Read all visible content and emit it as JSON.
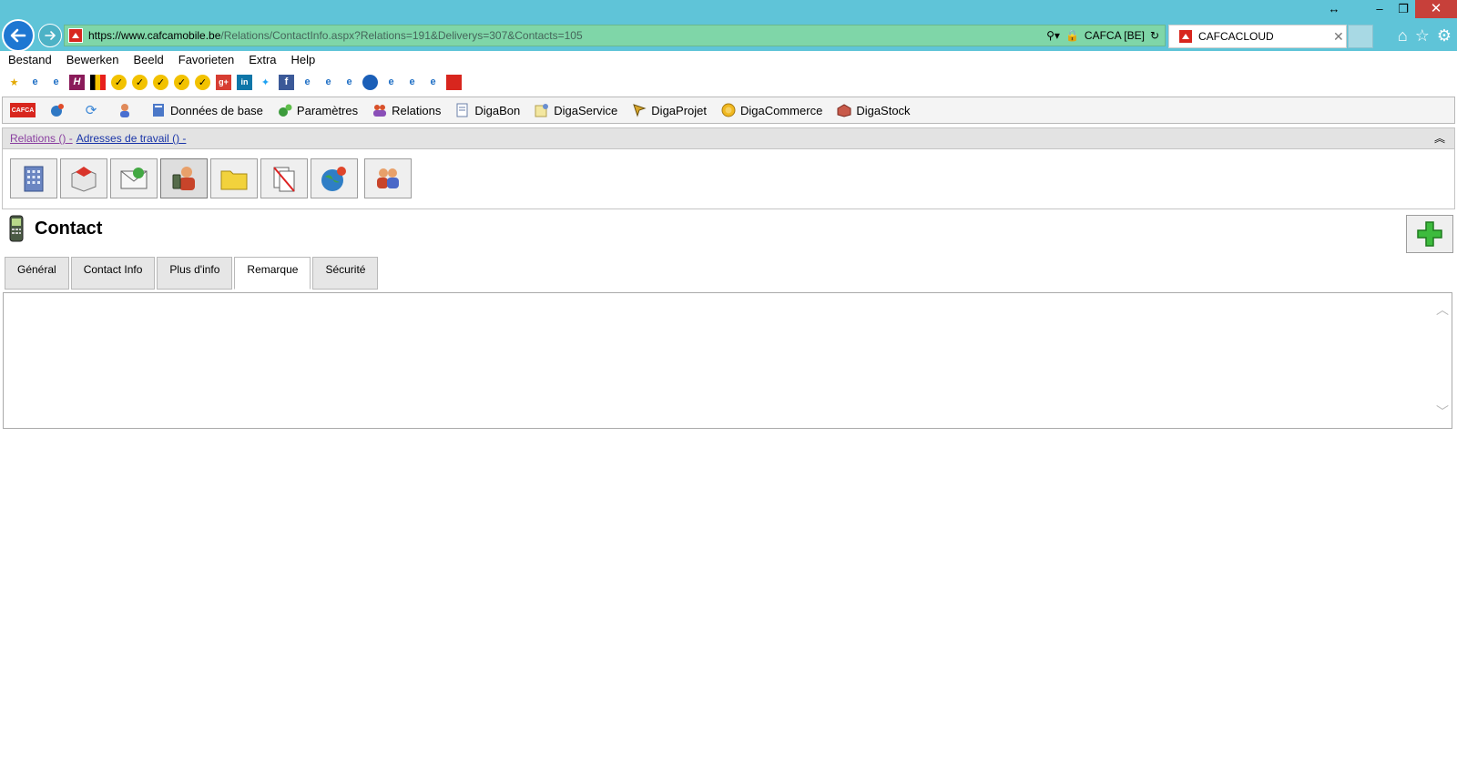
{
  "browser": {
    "url_scheme": "https://www.",
    "url_domain": "cafcamobile.be",
    "url_path": "/Relations/ContactInfo.aspx?Relations=191&Deliverys=307&Contacts=105",
    "cert_label": "CAFCA [BE]",
    "tab_title": "CAFCACLOUD"
  },
  "menu": [
    "Bestand",
    "Bewerken",
    "Beeld",
    "Favorieten",
    "Extra",
    "Help"
  ],
  "app_toolbar": {
    "items": [
      "Données de base",
      "Paramètres",
      "Relations",
      "DigaBon",
      "DigaService",
      "DigaProjet",
      "DigaCommerce",
      "DigaStock"
    ]
  },
  "breadcrumb": {
    "part1": "Relations () -",
    "part2": "Adresses de travail () -"
  },
  "contact": {
    "title": "Contact",
    "tabs": [
      "Général",
      "Contact Info",
      "Plus d'info",
      "Remarque",
      "Sécurité"
    ],
    "selected_tab": "Remarque",
    "remark_text": ""
  },
  "colors": {
    "titlebar": "#5fc4d8",
    "addressbar": "#7fd6a8",
    "accent_red": "#d8261e"
  }
}
